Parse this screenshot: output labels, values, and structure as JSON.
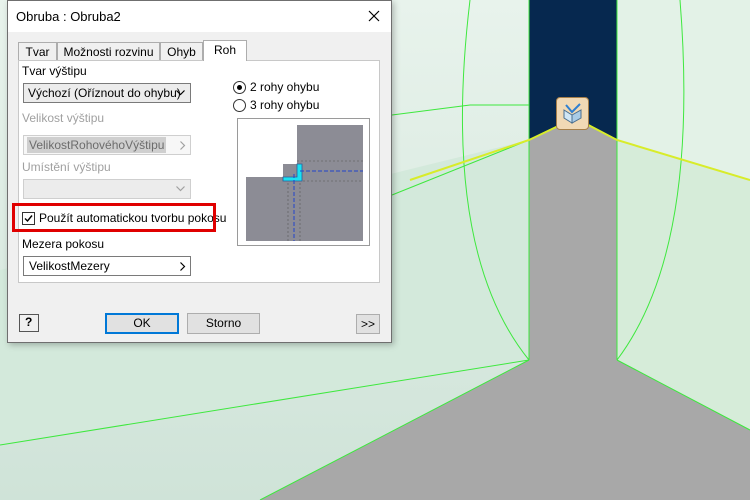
{
  "dialog": {
    "title": "Obruba : Obruba2",
    "tabs": [
      "Tvar",
      "Možnosti rozvinu",
      "Ohyb",
      "Roh"
    ],
    "active_tab": "Roh",
    "relief_shape_label": "Tvar výštipu",
    "relief_shape_value": "Výchozí (Oříznout do ohybu)",
    "relief_size_label": "Velikost výštipu",
    "relief_size_value": "VelikostRohovéhoVýštipu",
    "relief_placement_label": "Umístění výštipu",
    "relief_placement_value": "",
    "miter_checkbox_label": "Použít automatickou tvorbu pokosu",
    "miter_checkbox_checked": true,
    "miter_gap_label": "Mezera pokosu",
    "miter_gap_value": "VelikostMezery",
    "corner_options": [
      "2 rohy ohybu",
      "3 rohy ohybu"
    ],
    "selected_corner_option": "2 rohy ohybu",
    "ok_label": "OK",
    "cancel_label": "Storno",
    "more_label": ">>",
    "help_label": "?"
  },
  "colors": {
    "highlight": "#e00000",
    "accent_default_button": "#0078d7",
    "model_edge": "#3ee83e",
    "model_selected_edge": "#d8ec2a",
    "model_face_dark": "#06284f",
    "model_flat_face": "#a8a8a8"
  },
  "icons": [
    "close-icon",
    "chevron-down-icon",
    "chevron-right-icon",
    "checkmark-icon",
    "help-icon",
    "corner-edit-icon"
  ]
}
